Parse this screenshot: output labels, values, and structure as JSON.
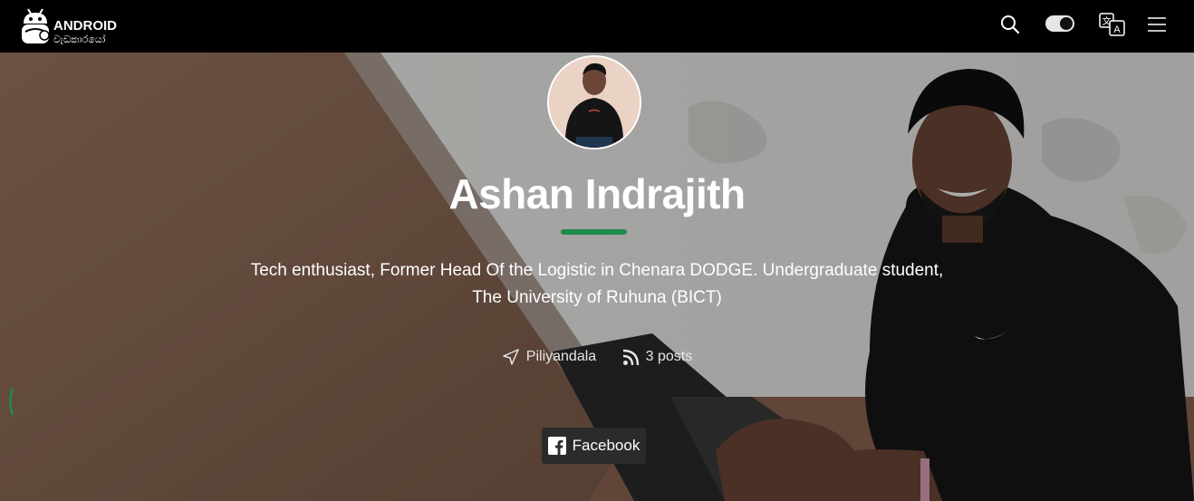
{
  "header": {
    "logo": {
      "line1": "ANDROID",
      "line2": "වැඩකාරයෝ"
    },
    "icons": [
      "search-icon",
      "theme-toggle",
      "translate-icon",
      "hamburger-menu-icon"
    ]
  },
  "author": {
    "name": "Ashan Indrajith",
    "bio": "Tech enthusiast, Former Head Of the Logistic in Chenara DODGE. Undergraduate student, The University of Ruhuna (BICT)",
    "location": "Piliyandala",
    "posts": "3 posts"
  },
  "social": [
    {
      "label": "Facebook",
      "icon": "facebook-icon"
    }
  ],
  "colors": {
    "header_bg": "#000000",
    "accent": "#1f8a4c",
    "button_bg": "#2b2b2b",
    "text": "#ffffff"
  }
}
